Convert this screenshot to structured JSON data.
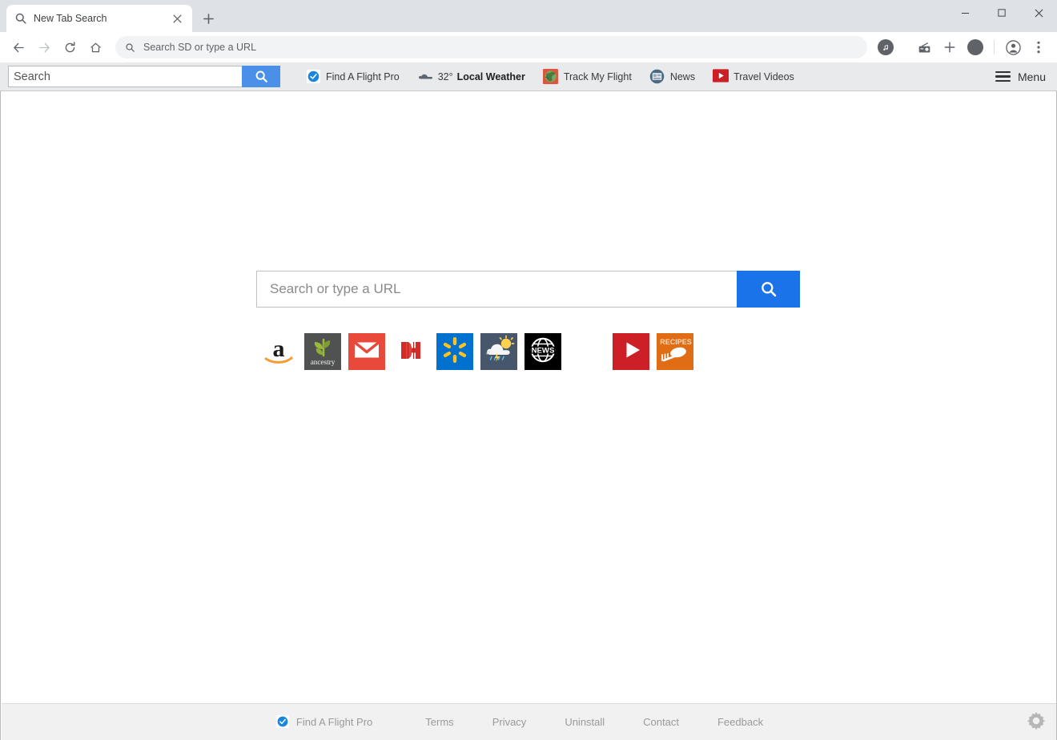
{
  "window": {
    "controls": {
      "minimize": "–",
      "maximize": "▢",
      "close": "✕"
    }
  },
  "tabstrip": {
    "tab": {
      "title": "New Tab Search",
      "favicon": "search-icon",
      "close": "close-icon"
    },
    "new_tab": "+"
  },
  "toolbar": {
    "back": "back-arrow-icon",
    "forward": "forward-arrow-icon",
    "reload": "reload-icon",
    "home": "home-icon",
    "omnibox": {
      "placeholder": "Search SD or type a URL",
      "value": "",
      "icon": "search-icon"
    },
    "right_icons": [
      "music-note-icon",
      "radio-icon",
      "plus-icon",
      "compass-icon",
      "profile-icon",
      "three-dot-menu-icon"
    ]
  },
  "extension_bar": {
    "search": {
      "placeholder": "Search",
      "value": "",
      "button_icon": "search-icon"
    },
    "links": [
      {
        "label": "Find A Flight Pro",
        "icon": "blue-check-badge-icon",
        "bold": false
      },
      {
        "label": "Local Weather",
        "icon": "cloud-icon",
        "bold": true,
        "temperature": "32°"
      },
      {
        "label": "Track My Flight",
        "icon": "globe-plane-icon",
        "bold": false
      },
      {
        "label": "News",
        "icon": "newspaper-icon",
        "bold": false
      },
      {
        "label": "Travel Videos",
        "icon": "youtube-play-icon",
        "bold": false
      }
    ],
    "menu": {
      "label": "Menu",
      "icon": "hamburger-icon"
    }
  },
  "main": {
    "search": {
      "placeholder": "Search or type a URL",
      "value": "",
      "button_icon": "search-icon"
    },
    "shortcuts": [
      {
        "name": "amazon",
        "icon": "amazon-icon",
        "bg": "#ffffff"
      },
      {
        "name": "ancestry",
        "icon": "ancestry-icon",
        "bg": "#4f5250"
      },
      {
        "name": "gmail",
        "icon": "gmail-icon",
        "bg": "#e8493a"
      },
      {
        "name": "hotels",
        "icon": "hotels-h-icon",
        "bg": "#ffffff"
      },
      {
        "name": "walmart",
        "icon": "walmart-spark-icon",
        "bg": "#0071ce"
      },
      {
        "name": "weather",
        "icon": "weather-cloud-icon",
        "bg": "#47566b"
      },
      {
        "name": "news",
        "icon": "news-globe-icon",
        "bg": "#000000"
      },
      {
        "name": "empty",
        "icon": "blank-tile",
        "bg": "transparent"
      },
      {
        "name": "youtube",
        "icon": "youtube-icon",
        "bg": "#cc2026"
      },
      {
        "name": "recipes",
        "icon": "recipes-icon",
        "bg": "#e06c16"
      }
    ]
  },
  "footer": {
    "brand": {
      "label": "Find A Flight Pro",
      "icon": "blue-check-badge-icon"
    },
    "links": [
      "Terms",
      "Privacy",
      "Uninstall",
      "Contact",
      "Feedback"
    ],
    "settings": "gear-icon"
  },
  "colors": {
    "accent_blue": "#1a73e8",
    "ext_button_blue": "#4a90e8",
    "chrome_bg": "#dee1e6",
    "ext_bar_bg": "#e9eaec",
    "footer_bg": "#f1f1f1",
    "footer_text": "#9a9a9a"
  }
}
